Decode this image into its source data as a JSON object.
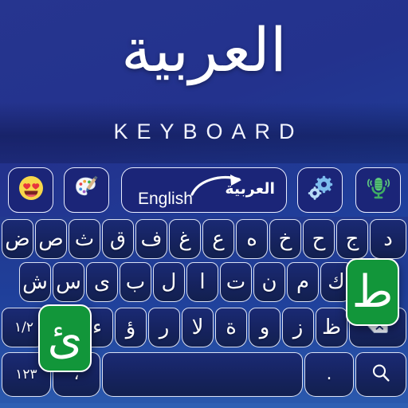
{
  "app": {
    "title_arabic": "العربية",
    "title_sub": "KEYBOARD",
    "accent_green": "#12963a",
    "brand_blue": "#26358f",
    "key_navy": "#16235f"
  },
  "toolbar": {
    "emoji_label": "emoji-button",
    "theme_label": "theme-button",
    "language": {
      "from": "English",
      "to": "العربية"
    },
    "settings_label": "settings-button",
    "mic_label": "voice-input-button"
  },
  "keyboard": {
    "row1": [
      "ض",
      "ص",
      "ث",
      "ق",
      "ف",
      "غ",
      "ع",
      "ه",
      "خ",
      "ح",
      "ج",
      "د"
    ],
    "row2": [
      "ش",
      "س",
      "ى",
      "ب",
      "ل",
      "ا",
      "ت",
      "ن",
      "م",
      "ك"
    ],
    "row3": {
      "shift": "١/٢",
      "letters": [
        "ئ",
        "ء",
        "ؤ",
        "ر",
        "لا",
        "ة",
        "و",
        "ز",
        "ظ"
      ],
      "backspace": "⌫"
    },
    "row4": {
      "numbers": "١٢٣",
      "comma": "،",
      "space": "",
      "period": ".",
      "search": "search-icon"
    },
    "popups": {
      "top": "ط",
      "bottom": "ئ"
    }
  }
}
